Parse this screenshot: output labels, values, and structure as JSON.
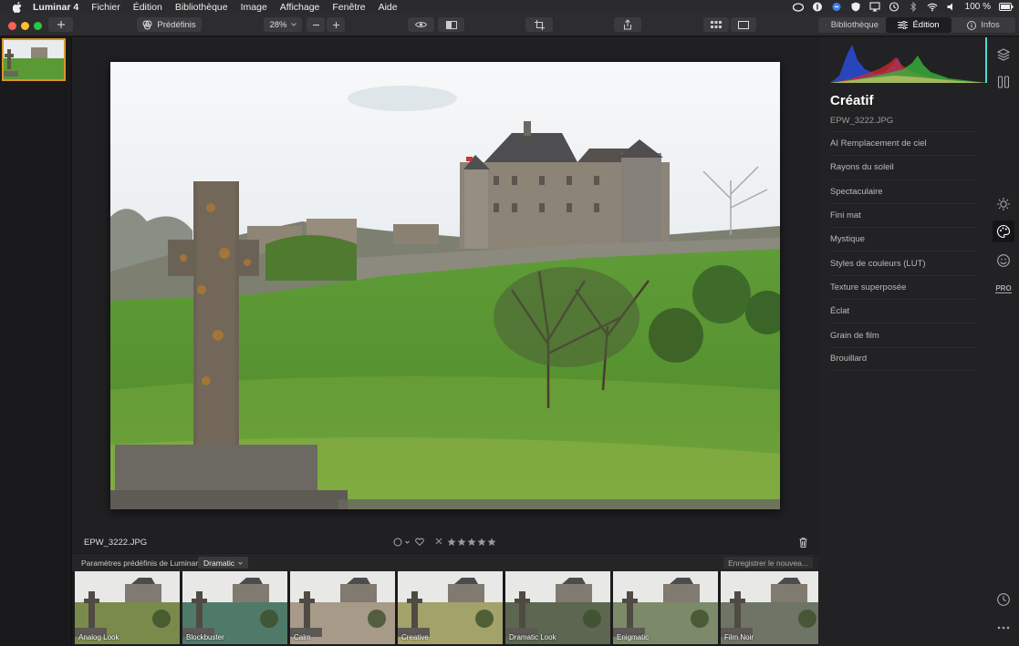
{
  "menubar": {
    "app_name": "Luminar 4",
    "items": [
      "Fichier",
      "Édition",
      "Bibliothèque",
      "Image",
      "Affichage",
      "Fenêtre",
      "Aide"
    ],
    "battery": "100 %"
  },
  "toolbar": {
    "presets_label": "Prédéfinis",
    "zoom": "28%",
    "tabs": [
      {
        "label": "Bibliothèque",
        "active": false
      },
      {
        "label": "Édition",
        "active": true
      },
      {
        "label": "Infos",
        "active": false
      }
    ]
  },
  "photo": {
    "filename": "EPW_3222.JPG"
  },
  "presets_bar": {
    "label": "Paramètres prédéfinis de Luminar :",
    "selected": "Dramatic",
    "save_label": "Enregistrer le nouvea..."
  },
  "presets": [
    {
      "label": "Analog Look",
      "tint": "#7a8a4a"
    },
    {
      "label": "Blockbuster",
      "tint": "#4f7a6a"
    },
    {
      "label": "Calm",
      "tint": "#a89a88"
    },
    {
      "label": "Creative",
      "tint": "#a3a26a"
    },
    {
      "label": "Dramatic Look",
      "tint": "#5c6650"
    },
    {
      "label": "Enigmatic",
      "tint": "#7d8a6a"
    },
    {
      "label": "Film Noir",
      "tint": "#6e7466"
    }
  ],
  "panel": {
    "title": "Créatif",
    "filename": "EPW_3222.JPG",
    "items": [
      "AI Remplacement de ciel",
      "Rayons du soleil",
      "Spectaculaire",
      "Fini mat",
      "Mystique",
      "Styles de couleurs (LUT)",
      "Texture superposée",
      "Éclat",
      "Grain de film",
      "Brouillard"
    ]
  },
  "rail": {
    "pro_label": "PRO"
  },
  "colors": {
    "accent": "#d8972c",
    "panel_bg": "#222224",
    "close": "#fe5f57",
    "minimize": "#febc2e",
    "zoom": "#28c840"
  }
}
